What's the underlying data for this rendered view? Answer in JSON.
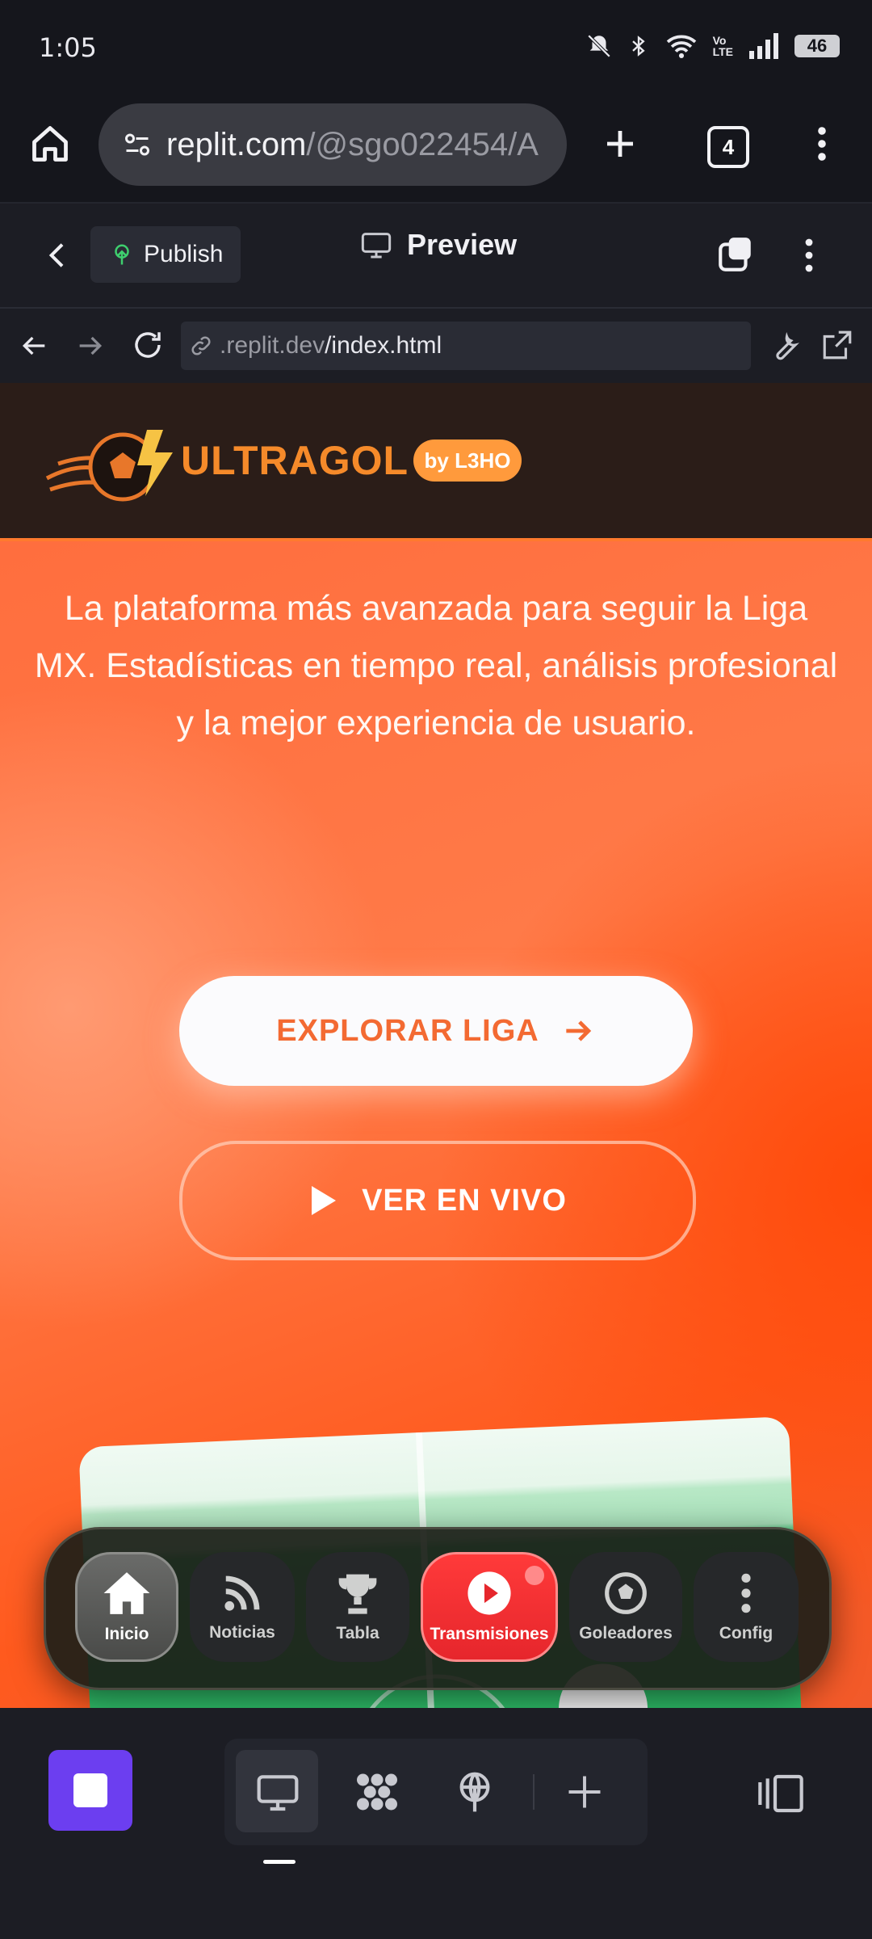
{
  "status_bar": {
    "time": "1:05",
    "battery": "46"
  },
  "browser": {
    "url_host": "replit.com",
    "url_path": "/@sgo022454/A",
    "tab_count": "4"
  },
  "replit_header": {
    "publish_label": "Publish",
    "preview_label": "Preview"
  },
  "preview_address": {
    "host_dim": ".replit.dev",
    "path": "/index.html"
  },
  "site": {
    "logo_text": "ULTRAGOL",
    "badge": "by L3HO",
    "hero_text": "La plataforma más avanzada para seguir la Liga MX. Estadísticas en tiempo real, análisis profesional y la mejor experiencia de usuario.",
    "explore_button": "EXPLORAR LIGA",
    "live_button": "VER EN VIVO",
    "nav": [
      {
        "label": "Inicio",
        "icon": "home-icon"
      },
      {
        "label": "Noticias",
        "icon": "rss-icon"
      },
      {
        "label": "Tabla",
        "icon": "trophy-icon"
      },
      {
        "label": "Transmisiones",
        "icon": "play-icon"
      },
      {
        "label": "Goleadores",
        "icon": "soccer-ball-icon"
      },
      {
        "label": "Config",
        "icon": "more-vertical-icon"
      }
    ]
  },
  "colors": {
    "accent_orange": "#ff6e3e",
    "live_red": "#ff3a3a",
    "replit_purple": "#6c3ef0"
  }
}
